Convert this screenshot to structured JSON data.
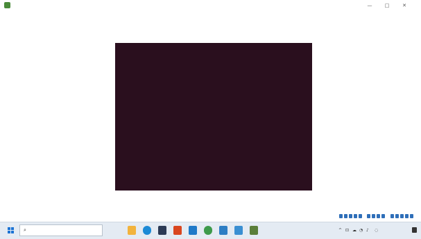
{
  "window": {
    "title": "",
    "minimize_icon": "minimize-icon",
    "maximize_icon": "maximize-icon",
    "close_icon": "close-icon",
    "minimize_glyph": "—",
    "maximize_glyph": "□",
    "close_glyph": "✕"
  },
  "menubar": {
    "items": [
      {
        "label": ""
      },
      {
        "label": ""
      },
      {
        "label": ""
      },
      {
        "label": ""
      },
      {
        "label": ""
      },
      {
        "label": ""
      }
    ]
  },
  "vm_console": {
    "background": "#2a0f1e",
    "text_color": "#d8cfd4",
    "boot_menu": [
      "",
      "",
      "",
      "",
      "",
      ""
    ],
    "function_keys": [
      {
        "label": ""
      },
      {
        "label": ""
      },
      {
        "label": ""
      },
      {
        "label": ""
      },
      {
        "label": ""
      },
      {
        "label": ""
      }
    ]
  },
  "taskbar": {
    "start_icon": "windows-start-icon",
    "search_icon": "search-icon",
    "search_glyph": "⌕",
    "search_placeholder": "",
    "pinned_apps": [
      {
        "icon": "file-explorer-icon",
        "color": "#f2b33d"
      },
      {
        "icon": "edge-browser-icon",
        "color": "#1c8ad6"
      },
      {
        "icon": "store-icon",
        "color": "#2b3a55"
      },
      {
        "icon": "mail-icon",
        "color": "#d9461f"
      },
      {
        "icon": "photos-icon",
        "color": "#1e79c8"
      },
      {
        "icon": "chrome-icon",
        "color": "#3d9a4b"
      },
      {
        "icon": "settings-icon",
        "color": "#2d7ec4"
      },
      {
        "icon": "network-app-icon",
        "color": "#3a8fd2"
      },
      {
        "icon": "virtualbox-icon",
        "color": "#5b7f3a"
      }
    ],
    "tray": {
      "clock_time": "",
      "clock_date": "",
      "chevron_icon": "chevron-up-icon",
      "notification_icon": "notification-icon",
      "accent_color": "#2f6fb9"
    }
  }
}
